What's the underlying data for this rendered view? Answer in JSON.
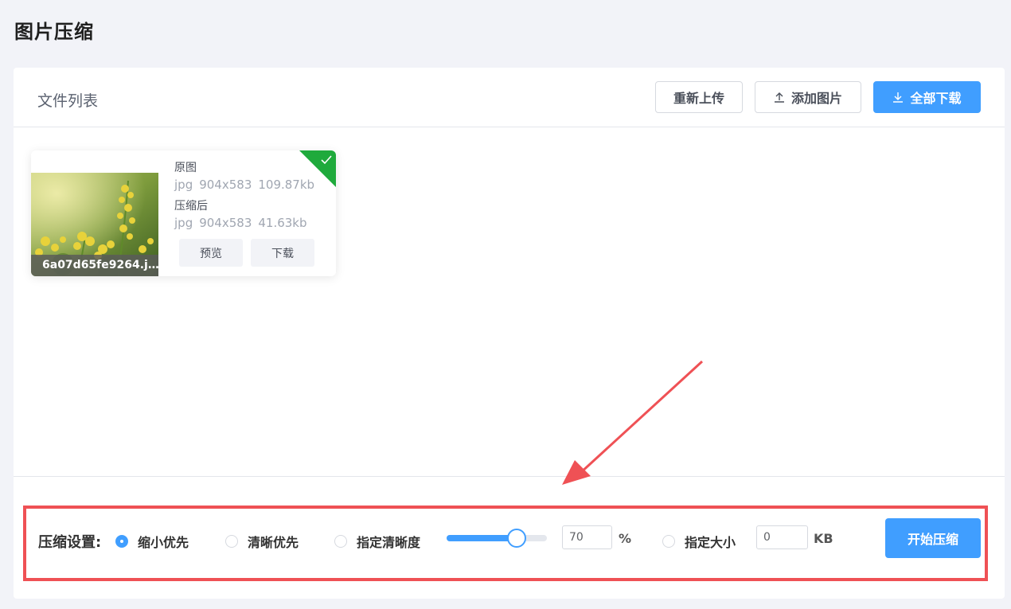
{
  "page": {
    "title": "图片压缩"
  },
  "file_list": {
    "title": "文件列表",
    "buttons": {
      "reupload": "重新上传",
      "add_image": "添加图片",
      "download_all": "全部下载"
    }
  },
  "file_card": {
    "filename": "6a07d65fe9264.j…",
    "original": {
      "label": "原图",
      "format": "jpg",
      "dimensions": "904x583",
      "size": "109.87kb"
    },
    "compressed": {
      "label": "压缩后",
      "format": "jpg",
      "dimensions": "904x583",
      "size": "41.63kb"
    },
    "preview_label": "预览",
    "download_label": "下载",
    "status": "done"
  },
  "settings": {
    "label": "压缩设置:",
    "options": {
      "shrink_first": "缩小优先",
      "clarity_first": "清晰优先",
      "specify_clarity": "指定清晰度",
      "specify_size": "指定大小"
    },
    "selected": "shrink_first",
    "quality_value": "70",
    "quality_percent": 70,
    "quality_unit": "%",
    "size_value": "0",
    "size_unit": "KB",
    "start_label": "开始压缩"
  },
  "colors": {
    "primary": "#409eff",
    "success": "#1faa3c",
    "highlight": "#ef5155"
  }
}
